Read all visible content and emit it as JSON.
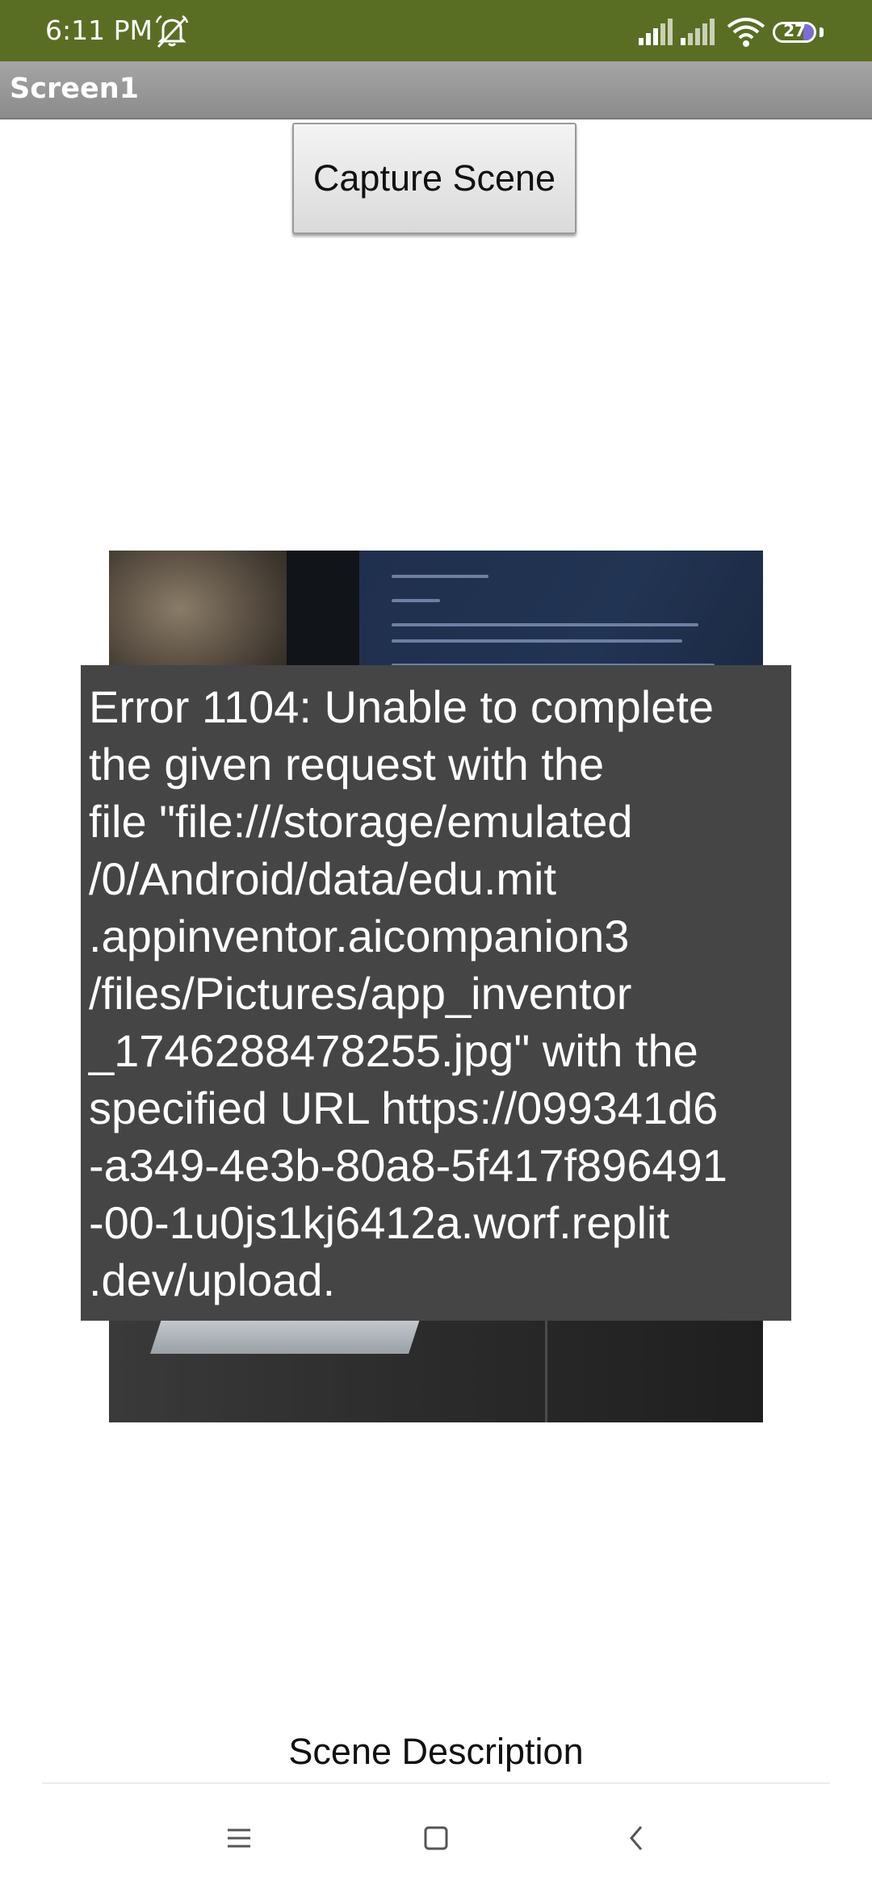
{
  "status_bar": {
    "time": "6:11 PM",
    "battery_level": "27",
    "battery_fraction": 0.27,
    "icons": [
      "dnd-off-icon",
      "signal-icon",
      "signal-icon",
      "wifi-icon",
      "battery-icon"
    ],
    "background_color": "#5a6e23"
  },
  "title_bar": {
    "title": "Screen1"
  },
  "capture_button": {
    "label": "Capture Scene"
  },
  "photo": {
    "description_icon": "captured-image"
  },
  "error_toast": {
    "lines": [
      "Error 1104: Unable to complete",
      "the given request with the",
      "file \"file:///storage/emulated",
      "/0/Android/data/edu.mit",
      ".appinventor.aicompanion3",
      "/files/Pictures/app_inventor",
      "_1746288478255.jpg\" with the",
      "specified URL https://099341d6",
      "-a349-4e3b-80a8-5f417f896491",
      "-00-1u0js1kj6412a.worf.replit",
      ".dev/upload."
    ]
  },
  "scene_description": {
    "label": "Scene Description"
  },
  "nav_bar": {
    "icons": [
      "menu-icon",
      "home-icon",
      "back-icon"
    ]
  }
}
